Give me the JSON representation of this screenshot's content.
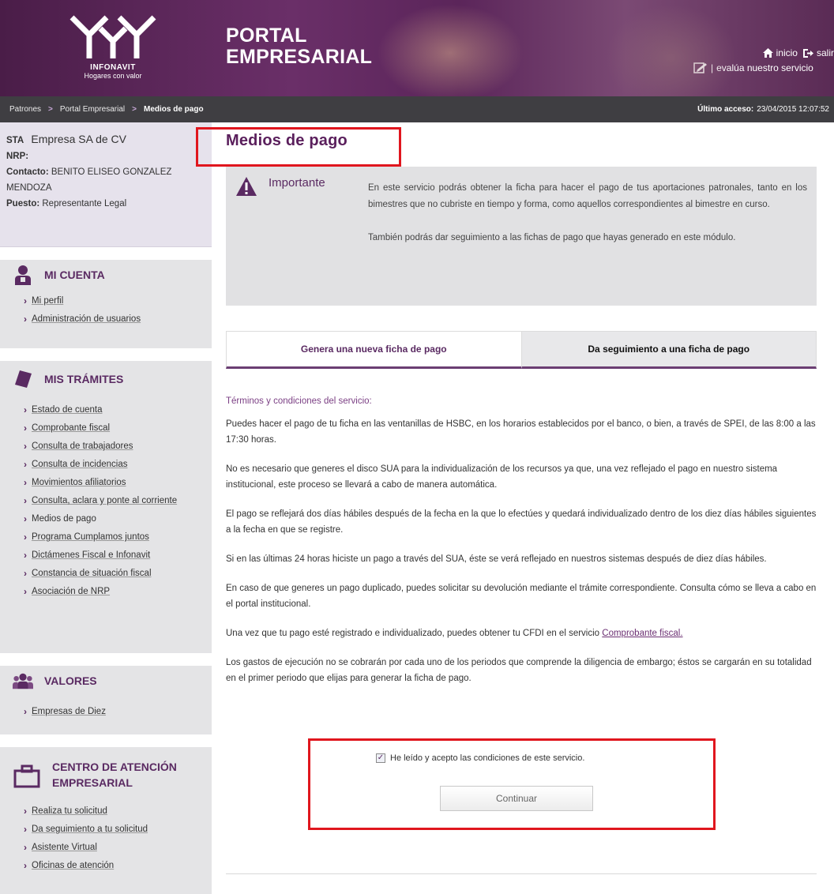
{
  "header": {
    "logo_name": "INFONAVIT",
    "logo_tagline": "Hogares con valor",
    "portal_title": "PORTAL\nEMPRESARIAL",
    "links": {
      "home": "inicio",
      "logout": "salir",
      "evaluate": "evalúa nuestro servicio"
    }
  },
  "breadcrumb": {
    "items": [
      "Patrones",
      "Portal Empresarial",
      "Medios de pago"
    ],
    "separator": ">",
    "last_access_label": "Último acceso:",
    "last_access_value": "23/04/2015 12:07:52"
  },
  "sidebar": {
    "company": {
      "prefix": "STA",
      "name": "Empresa SA de CV",
      "nrp_label": "NRP:",
      "nrp_value": "",
      "contact_label": "Contacto:",
      "contact_value": "BENITO ELISEO GONZALEZ MENDOZA",
      "position_label": "Puesto:",
      "position_value": "Representante Legal"
    },
    "sections": [
      {
        "title": "MI CUENTA",
        "icon": "user-icon",
        "links": [
          "Mi perfil",
          "Administración de usuarios"
        ]
      },
      {
        "title": "MIS TRÁMITES",
        "icon": "document-icon",
        "links": [
          "Estado de cuenta",
          "Comprobante fiscal",
          "Consulta de trabajadores",
          "Consulta de incidencias",
          "Movimientos afiliatorios",
          "Consulta, aclara y ponte al corriente",
          "Medios de pago",
          "Programa Cumplamos juntos",
          "Dictámenes Fiscal e Infonavit",
          "Constancia de situación fiscal",
          "Asociación de NRP"
        ]
      },
      {
        "title": "VALORES",
        "icon": "group-icon",
        "links": [
          "Empresas de Diez"
        ]
      },
      {
        "title": "CENTRO DE ATENCIÓN EMPRESARIAL",
        "icon": "briefcase-icon",
        "links": [
          "Realiza tu solicitud",
          "Da seguimiento a tu solicitud",
          "Asistente Virtual",
          "Oficinas de atención"
        ]
      }
    ]
  },
  "main": {
    "title": "Medios de pago",
    "notice": {
      "label": "Importante",
      "paragraphs": [
        "En este servicio podrás obtener la ficha para hacer el pago de tus aportaciones patronales, tanto en los bimestres que no cubriste en tiempo y forma, como aquellos correspondientes al bimestre en curso.",
        "También podrás dar seguimiento a las fichas de pago que hayas generado en este módulo."
      ]
    },
    "tabs": [
      {
        "label": "Genera una nueva ficha de pago",
        "active": true
      },
      {
        "label": "Da seguimiento a una ficha de pago",
        "active": false
      }
    ],
    "terms_heading": "Términos y condiciones del servicio:",
    "terms": [
      "Puedes hacer el pago de tu ficha en las ventanillas de HSBC, en los horarios establecidos por el banco, o bien, a través de SPEI, de las 8:00 a las 17:30 horas.",
      "No es necesario que generes el disco SUA para la individualización de los recursos ya que, una vez reflejado el pago en nuestro sistema institucional, este proceso se llevará a cabo de manera automática.",
      "El pago se reflejará dos días hábiles después de la fecha en la que lo efectúes y quedará individualizado dentro de los diez días hábiles siguientes a la fecha en que se registre.",
      "Si en las últimas 24 horas hiciste un pago a través del SUA, éste se verá reflejado en nuestros sistemas después de diez días hábiles.",
      "En caso de que generes un pago duplicado, puedes solicitar su devolución mediante el trámite correspondiente. Consulta cómo se lleva a cabo en el portal institucional."
    ],
    "cfdi_text": "Una vez que tu pago esté registrado e individualizado, puedes obtener tu CFDI en el servicio",
    "cfdi_link": "Comprobante fiscal.",
    "expenses_text": "Los gastos de ejecución no se cobrarán por cada uno de los periodos que comprende la diligencia de embargo; éstos se cargarán en su totalidad en el primer periodo que elijas para generar la ficha de pago.",
    "accept_label": "He leído y acepto las condiciones de este servicio.",
    "accept_checked": true,
    "continue_label": "Continuar"
  },
  "colors": {
    "brand_purple": "#5a2a62",
    "highlight_red": "#e0161e",
    "breadcrumb_bg": "#3f3e42",
    "sidebar_bg": "#e4e4e6"
  }
}
